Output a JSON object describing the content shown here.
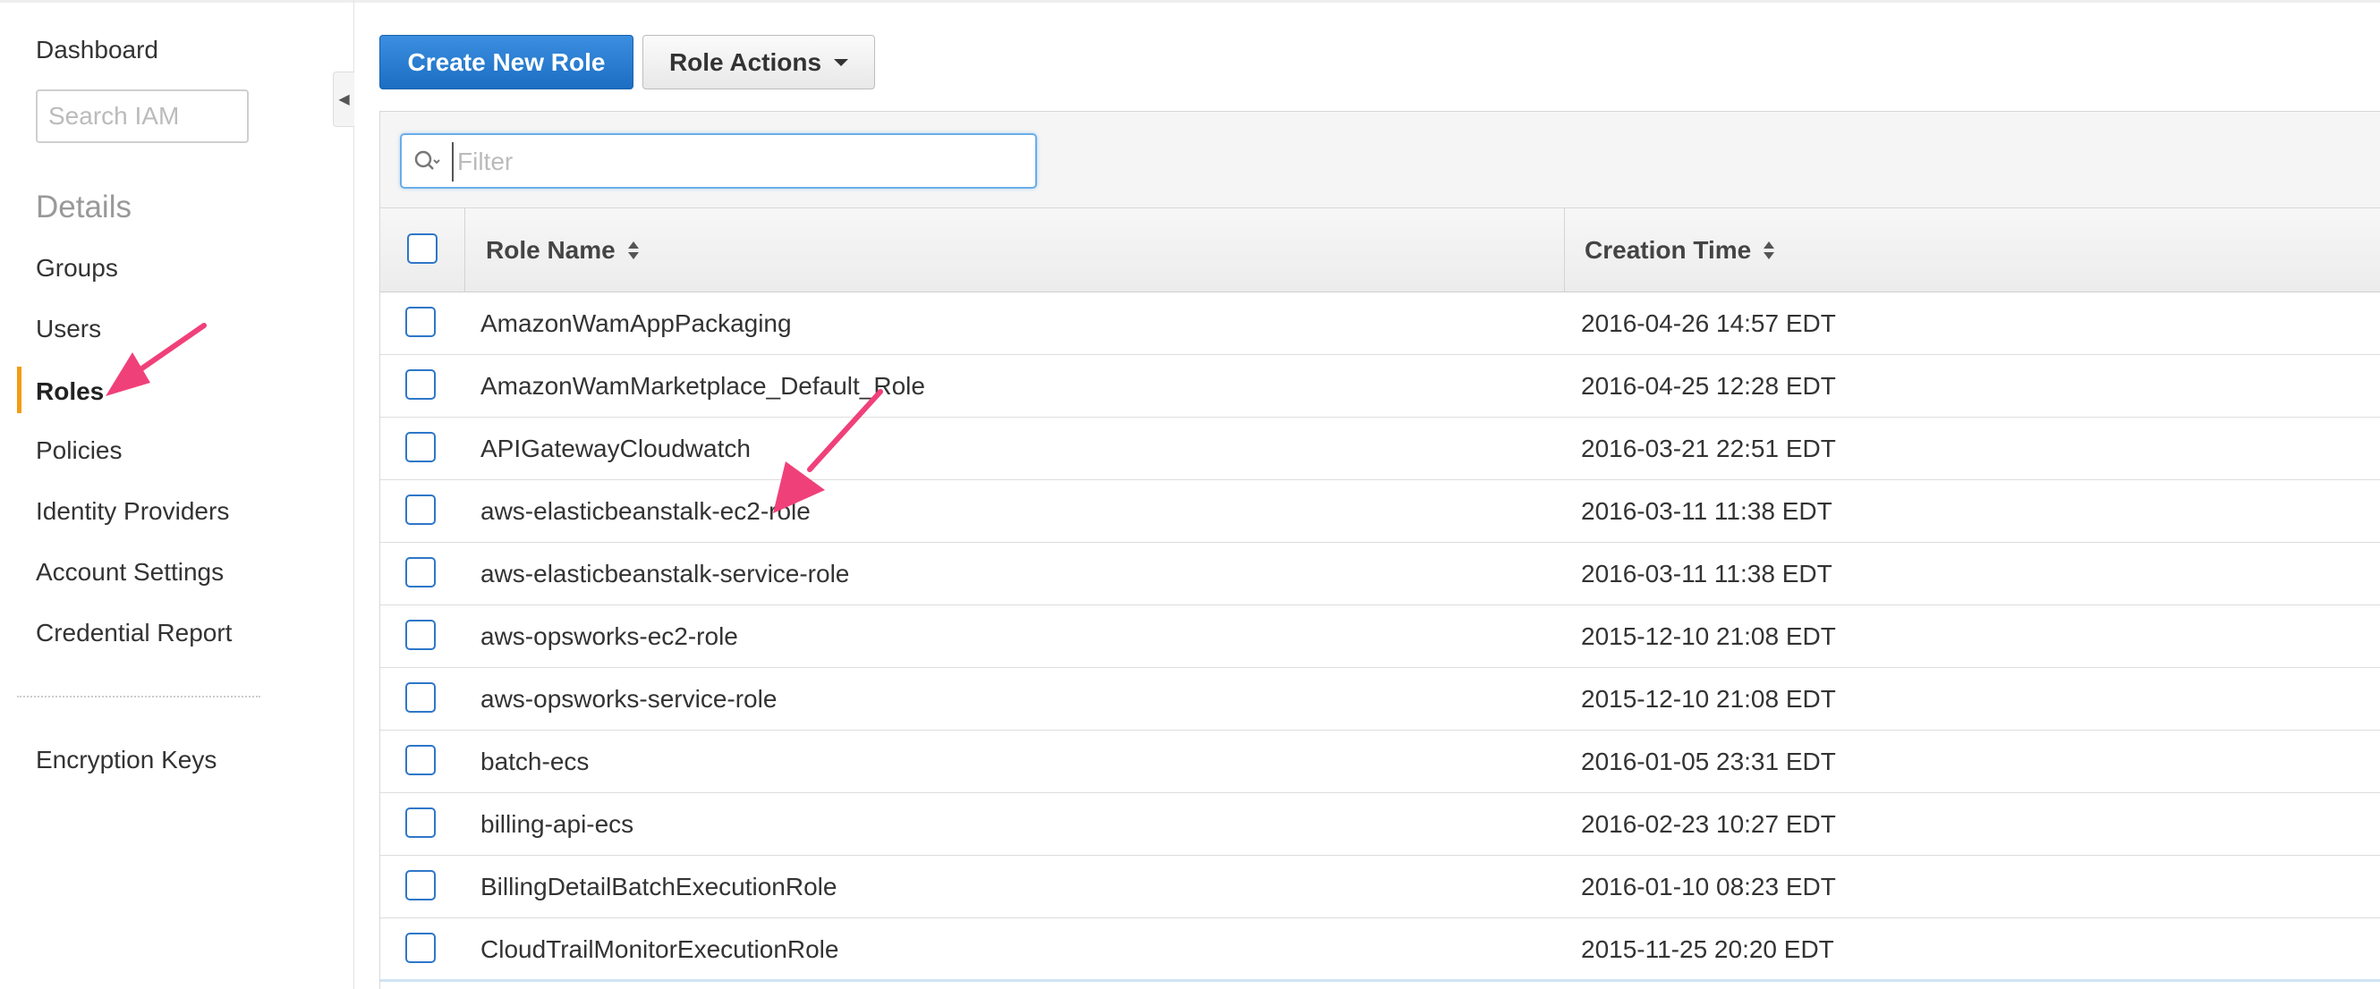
{
  "sidebar": {
    "dashboard_label": "Dashboard",
    "search_placeholder": "Search IAM",
    "details_heading": "Details",
    "items": [
      {
        "label": "Groups",
        "active": false
      },
      {
        "label": "Users",
        "active": false
      },
      {
        "label": "Roles",
        "active": true
      },
      {
        "label": "Policies",
        "active": false
      },
      {
        "label": "Identity Providers",
        "active": false
      },
      {
        "label": "Account Settings",
        "active": false
      },
      {
        "label": "Credential Report",
        "active": false
      }
    ],
    "encryption_label": "Encryption Keys",
    "active_color": "#f39c12"
  },
  "toolbar": {
    "create_label": "Create New Role",
    "actions_label": "Role Actions"
  },
  "filter": {
    "placeholder": "Filter",
    "icon": "search-dropdown-icon"
  },
  "table": {
    "columns": {
      "name": "Role Name",
      "time": "Creation Time"
    },
    "rows": [
      {
        "name": "AmazonWamAppPackaging",
        "time": "2016-04-26 14:57 EDT"
      },
      {
        "name": "AmazonWamMarketplace_Default_Role",
        "time": "2016-04-25 12:28 EDT"
      },
      {
        "name": "APIGatewayCloudwatch",
        "time": "2016-03-21 22:51 EDT"
      },
      {
        "name": "aws-elasticbeanstalk-ec2-role",
        "time": "2016-03-11 11:38 EDT"
      },
      {
        "name": "aws-elasticbeanstalk-service-role",
        "time": "2016-03-11 11:38 EDT"
      },
      {
        "name": "aws-opsworks-ec2-role",
        "time": "2015-12-10 21:08 EDT"
      },
      {
        "name": "aws-opsworks-service-role",
        "time": "2015-12-10 21:08 EDT"
      },
      {
        "name": "batch-ecs",
        "time": "2016-01-05 23:31 EDT"
      },
      {
        "name": "billing-api-ecs",
        "time": "2016-02-23 10:27 EDT"
      },
      {
        "name": "BillingDetailBatchExecutionRole",
        "time": "2016-01-10 08:23 EDT"
      },
      {
        "name": "CloudTrailMonitorExecutionRole",
        "time": "2015-11-25 20:20 EDT"
      }
    ]
  },
  "colors": {
    "primary_button": "#1f74c9",
    "checkbox_border": "#2e77c9",
    "annotation_arrow": "#f0407a"
  }
}
